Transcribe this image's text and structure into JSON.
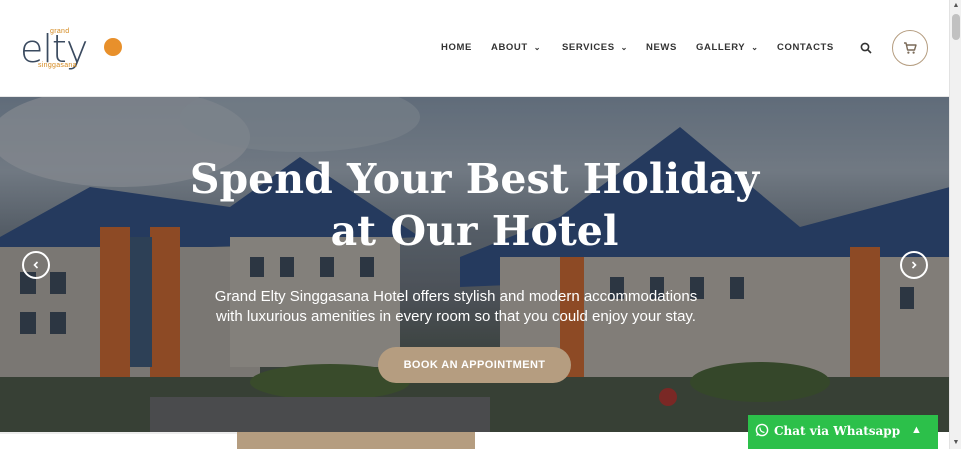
{
  "logo": {
    "top": "grand",
    "word": "elty",
    "bottom": "singgasana"
  },
  "nav": {
    "home": "HOME",
    "about": "ABOUT",
    "services": "SERVICES",
    "news": "NEWS",
    "gallery": "GALLERY",
    "contacts": "CONTACTS",
    "search_icon": "search-icon",
    "cart_icon": "cart-icon"
  },
  "hero": {
    "title_line1": "Spend Your Best Holiday",
    "title_line2": "at Our Hotel",
    "text_line1": "Grand Elty Singgasana Hotel offers stylish and modern accommodations",
    "text_line2": "with luxurious amenities in every room so that you could enjoy your stay.",
    "button": "BOOK AN APPOINTMENT",
    "prev_icon": "chevron-left-icon",
    "next_icon": "chevron-right-icon"
  },
  "whatsapp": {
    "label": "Chat via Whatsapp"
  },
  "colors": {
    "accent": "#b59d80",
    "logo_orange": "#e8902b",
    "whatsapp_green": "#2cc04a"
  }
}
